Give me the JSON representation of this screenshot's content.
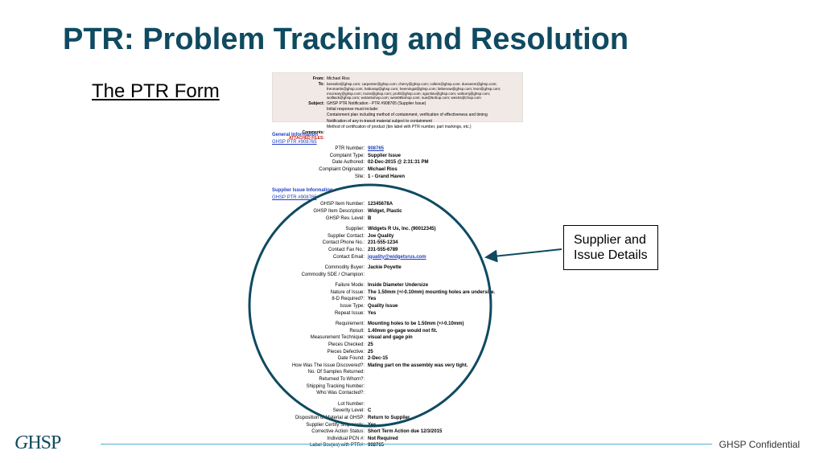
{
  "title": "PTR: Problem Tracking and Resolution",
  "subtitle": "The PTR Form",
  "header": {
    "from_label": "From:",
    "from": "Michael Rios",
    "to_label": "To:",
    "to": "benedict@ghsp.com; carpenter@ghsp.com; cherry@ghsp.com; collem@ghsp.com; dunseem@ghsp.com; frenmartin@ghsp.com; haltonap@ghsp.com; heemingal@ghsp.com; liebenow@ghsp.com; leon@ghsp.com; mccreary@ghsp.com; moss@ghsp.com; prohl@ghsp.com; sgorslav@ghsp.com; woltornj@ghsp.com; wolltack@ghsp.com; wolan5ohop.com; weis085ohop.com; sue@5ohop.com; wesSs@chop.com",
    "subject_label": "Subject:",
    "subject": "GHSP PTR Notification - PTR #908765 (Supplier Issue)",
    "body1": "Initial response must include:",
    "body2": "Containment plan including method of containment, verification of effectiveness and timing",
    "body3": "Notification of any in-transit material subject to containment",
    "body4": "Method of certification of product (bin label with PTR number, part markings, etc.)",
    "comments_label": "Comments:",
    "attached": "ATTACHED FILES:"
  },
  "general": {
    "heading": "General Information",
    "link": "GHSP PTR #908765",
    "rows": [
      {
        "label": "PTR Number:",
        "value": "908765",
        "link": true
      },
      {
        "label": "Complaint Type:",
        "value": "Supplier Issue"
      },
      {
        "label": "Date Authored:",
        "value": "02-Dec-2015 @ 2:31:31 PM"
      },
      {
        "label": "Complaint Originator:",
        "value": "Michael Rios"
      },
      {
        "label": "Site:",
        "value": "1 - Grand Haven"
      }
    ]
  },
  "supplier": {
    "heading": "Supplier Issue Information",
    "link": "GHSP PTR #908765",
    "rows": [
      {
        "label": "GHSP Item Number:",
        "value": "12345678A"
      },
      {
        "label": "GHSP Item Description:",
        "value": "Widget, Plastic"
      },
      {
        "label": "GHSP Rev. Level:",
        "value": "B"
      }
    ],
    "rows2": [
      {
        "label": "Supplier:",
        "value": "Widgets R Us, Inc. (90012345)"
      },
      {
        "label": "Supplier Contact:",
        "value": "Joe Quality"
      },
      {
        "label": "Contact Phone No.:",
        "value": "231-555-1234"
      },
      {
        "label": "Contact Fax No.:",
        "value": "231-555-6789"
      },
      {
        "label": "Contact Email:",
        "value": "jquality@widgetsrus.com",
        "link": true
      }
    ],
    "rows3": [
      {
        "label": "Commodity Buyer:",
        "value": "Jackie Poyette"
      },
      {
        "label": "Commodity SDE / Champion:",
        "value": ""
      }
    ],
    "rows4": [
      {
        "label": "Failure Mode:",
        "value": "Inside Diameter Undersize"
      },
      {
        "label": "Nature of Issue:",
        "value": "The 1.50mm (+/-0.10mm) mounting holes are undersize."
      },
      {
        "label": "8-D Required?:",
        "value": "Yes"
      },
      {
        "label": "Issue Type:",
        "value": "Quality Issue"
      },
      {
        "label": "Repeat Issue:",
        "value": "Yes"
      }
    ],
    "rows5": [
      {
        "label": "Requirement:",
        "value": "Mounting holes to be 1.50mm (+/-0.10mm)"
      },
      {
        "label": "Result:",
        "value": "1.40mm go-gage would not fit."
      },
      {
        "label": "Measurement Technique:",
        "value": "visual and gage pin"
      },
      {
        "label": "Pieces Checked:",
        "value": "25"
      },
      {
        "label": "Pieces Defective:",
        "value": "25"
      },
      {
        "label": "Date Found:",
        "value": "2-Dec-15"
      },
      {
        "label": "How Was The Issue Discovered?:",
        "value": "Mating part on the assembly was very tight."
      },
      {
        "label": "No. Of Samples Returned:",
        "value": ""
      },
      {
        "label": "Returned To Whom?:",
        "value": ""
      },
      {
        "label": "Shipping Tracking Number:",
        "value": ""
      },
      {
        "label": "Who Was Contacted?:",
        "value": ""
      }
    ],
    "rows6": [
      {
        "label": "Lot Number:",
        "value": ""
      },
      {
        "label": "Severity Level:",
        "value": "C"
      },
      {
        "label": "Disposition of Material at GHSP:",
        "value": "Return to Supplier"
      },
      {
        "label": "Supplier Certify Shipments:",
        "value": "Yes"
      },
      {
        "label": "Corrective Action Status:",
        "value": "Short Term Action due 12/3/2015"
      },
      {
        "label": "Individual PCN #:",
        "value": "Not Required"
      },
      {
        "label": "Label Box(es) with PTR#:",
        "value": "908765"
      }
    ]
  },
  "callout": {
    "line1": "Supplier and",
    "line2": "Issue Details"
  },
  "footer": {
    "right": "GHSP Confidential",
    "logo1": "G",
    "logo2": "HSP"
  }
}
